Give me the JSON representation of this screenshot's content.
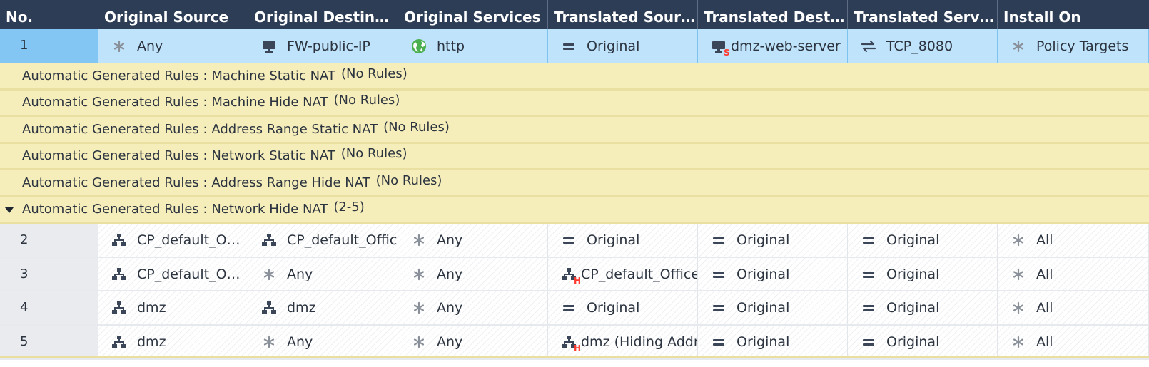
{
  "columns": [
    "No.",
    "Original Source",
    "Original Destinati...",
    "Original Services",
    "Translated Source",
    "Translated Destin...",
    "Translated Services",
    "Install On"
  ],
  "selected_rule": {
    "no": "1",
    "orig_source": {
      "icon": "asterisk-icon",
      "text": "Any"
    },
    "orig_dest": {
      "icon": "monitor-icon",
      "text": "FW-public-IP"
    },
    "orig_services": {
      "icon": "globe-icon",
      "text": "http"
    },
    "trans_source": {
      "icon": "equals-icon",
      "text": "Original"
    },
    "trans_dest": {
      "icon": "monitor-icon",
      "badge": "S",
      "text": "dmz-web-server"
    },
    "trans_services": {
      "icon": "swap-arrows-icon",
      "text": "TCP_8080"
    },
    "install_on": {
      "icon": "asterisk-icon",
      "text": "Policy Targets"
    }
  },
  "sections": [
    {
      "label": "Automatic Generated Rules : Machine Static NAT",
      "count": "(No Rules)"
    },
    {
      "label": "Automatic Generated Rules : Machine Hide NAT",
      "count": "(No Rules)"
    },
    {
      "label": "Automatic Generated Rules : Address Range Static NAT",
      "count": "(No Rules)"
    },
    {
      "label": "Automatic Generated Rules : Network Static NAT",
      "count": "(No Rules)"
    },
    {
      "label": "Automatic Generated Rules : Address Range Hide NAT",
      "count": "(No Rules)"
    },
    {
      "label": "Automatic Generated Rules : Network Hide NAT",
      "count": "(2-5)"
    }
  ],
  "rules": [
    {
      "no": "2",
      "orig_source": "CP_default_Offi...",
      "orig_dest": "CP_default_Office",
      "orig_services": "Any",
      "trans_source": "Original",
      "trans_dest": "Original",
      "trans_services": "Original",
      "install_on": "All"
    },
    {
      "no": "3",
      "orig_source": "CP_default_Offi...",
      "orig_dest": "Any",
      "orig_services": "Any",
      "trans_source": "CP_default_Office",
      "trans_source_badge": "H",
      "trans_dest": "Original",
      "trans_services": "Original",
      "install_on": "All"
    },
    {
      "no": "4",
      "orig_source": "dmz",
      "orig_dest": "dmz",
      "orig_services": "Any",
      "trans_source": "Original",
      "trans_dest": "Original",
      "trans_services": "Original",
      "install_on": "All"
    },
    {
      "no": "5",
      "orig_source": "dmz",
      "orig_dest": "Any",
      "orig_services": "Any",
      "trans_source": "dmz (Hiding Addr",
      "trans_source_badge": "H",
      "trans_dest": "Original",
      "trans_services": "Original",
      "install_on": "All"
    }
  ],
  "colors": {
    "header_bg": "#2d3d56",
    "selected_bg": "#bfe3fb",
    "section_bg": "#f6eeba",
    "badge": "#ff3b30",
    "globe": "#4caf50"
  }
}
